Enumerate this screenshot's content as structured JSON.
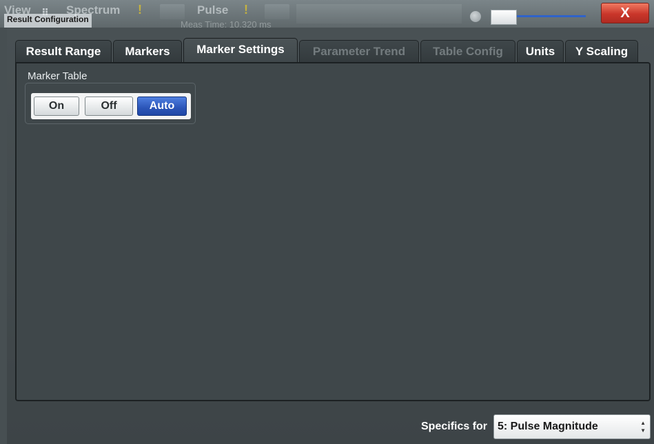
{
  "background": {
    "tabs": [
      {
        "label": "View"
      },
      {
        "label": "Spectrum"
      },
      {
        "label": "Pulse"
      }
    ],
    "sub_text": "Meas Time: 10.320 ms"
  },
  "dialog": {
    "title": "Result Configuration",
    "close_label": "X"
  },
  "tabs": [
    {
      "label": "Result Range",
      "state": "normal"
    },
    {
      "label": "Markers",
      "state": "normal"
    },
    {
      "label": "Marker Settings",
      "state": "active"
    },
    {
      "label": "Parameter Trend",
      "state": "disabled"
    },
    {
      "label": "Table Config",
      "state": "disabled"
    },
    {
      "label": "Units",
      "state": "normal"
    },
    {
      "label": "Y Scaling",
      "state": "normal"
    }
  ],
  "marker_table": {
    "label": "Marker Table",
    "options": [
      "On",
      "Off",
      "Auto"
    ],
    "selected": "Auto"
  },
  "footer": {
    "specifics_label": "Specifics for",
    "specifics_value": "5: Pulse Magnitude"
  },
  "colors": {
    "accent": "#2b55b8",
    "close_button": "#c9362a",
    "panel_background": "#3f474a"
  }
}
